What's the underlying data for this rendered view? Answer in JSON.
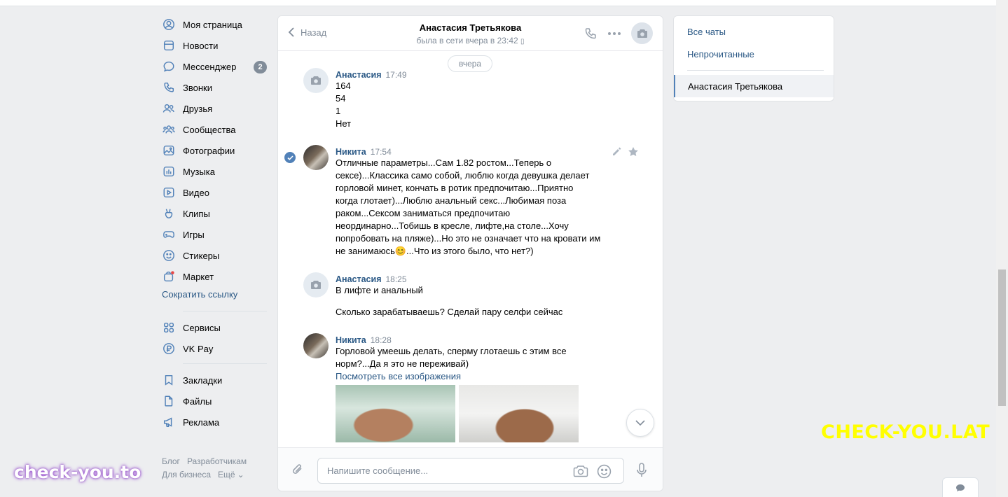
{
  "nav": {
    "items": [
      {
        "label": "Моя страница",
        "icon": "user-circle-icon"
      },
      {
        "label": "Новости",
        "icon": "newspaper-icon"
      },
      {
        "label": "Мессенджер",
        "icon": "chat-bubble-icon",
        "badge": "2"
      },
      {
        "label": "Звонки",
        "icon": "phone-icon"
      },
      {
        "label": "Друзья",
        "icon": "friends-icon"
      },
      {
        "label": "Сообщества",
        "icon": "communities-icon"
      },
      {
        "label": "Фотографии",
        "icon": "photo-icon"
      },
      {
        "label": "Музыка",
        "icon": "music-icon"
      },
      {
        "label": "Видео",
        "icon": "video-icon"
      },
      {
        "label": "Клипы",
        "icon": "clips-icon"
      },
      {
        "label": "Игры",
        "icon": "gamepad-icon"
      },
      {
        "label": "Стикеры",
        "icon": "smile-icon"
      },
      {
        "label": "Маркет",
        "icon": "shopping-bag-icon"
      }
    ],
    "shorten_link": "Сократить ссылку",
    "services": [
      {
        "label": "Сервисы",
        "icon": "grid-icon"
      },
      {
        "label": "VK Pay",
        "icon": "ruble-icon"
      }
    ],
    "extras": [
      {
        "label": "Закладки",
        "icon": "bookmark-icon"
      },
      {
        "label": "Файлы",
        "icon": "file-icon"
      },
      {
        "label": "Реклама",
        "icon": "megaphone-icon"
      }
    ],
    "footer": {
      "blog": "Блог",
      "dev": "Разработчикам",
      "business": "Для бизнеса",
      "more": "Ещё"
    }
  },
  "chat": {
    "back_label": "Назад",
    "peer_name": "Анастасия Третьякова",
    "peer_status": "была в сети вчера в 23:42",
    "date_divider": "вчера",
    "messages": [
      {
        "author": "Анастасия",
        "time": "17:49",
        "lines": [
          "164",
          "54",
          "1",
          "Нет"
        ]
      },
      {
        "author": "Никита",
        "time": "17:54",
        "lines": [
          "Отличные параметры...Сам 1.82 ростом...Теперь о",
          "сексе)...Классика само собой, люблю когда девушка делает",
          "горловой минет, кончать в ротик предпочитаю...Приятно",
          "когда глотает)...Люблю анальный секс...Любимая поза",
          "раком...Сексом заниматься предпочитаю",
          "неординарно...Тобишь в кресле, лифте,на столе...Хочу",
          "попробовать на пляже)...Но это не означает что на кровати им",
          "не занимаюсь😊...Что из этого было, что нет?)"
        ]
      },
      {
        "author": "Анастасия",
        "time": "18:25",
        "lines": [
          "В лифте и анальный"
        ],
        "extra": "Сколько зарабатываешь? Сделай пару селфи сейчас"
      },
      {
        "author": "Никита",
        "time": "18:28",
        "lines": [
          "Горловой умеешь делать, сперму глотаешь с этим все",
          "норм?...Да я это не переживай)"
        ],
        "link": "Посмотреть все изображения"
      }
    ],
    "composer_placeholder": "Напишите сообщение..."
  },
  "right_panel": {
    "all_chats": "Все чаты",
    "unread": "Непрочитанные",
    "active_chat": "Анастасия Третьякова"
  },
  "watermarks": {
    "top": "CHECK-YOU.LAT",
    "bottom": "check-you.to"
  },
  "colors": {
    "link": "#2a5885",
    "accent": "#5181b8",
    "muted": "#818c99",
    "bg": "#edeef0"
  }
}
